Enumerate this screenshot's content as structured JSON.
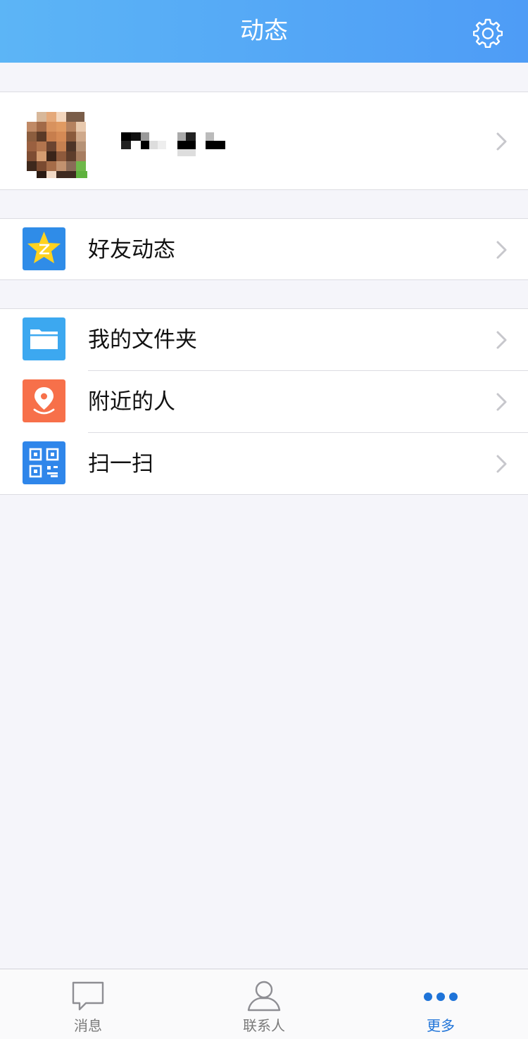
{
  "header": {
    "title": "动态",
    "settings_icon": "gear-icon"
  },
  "profile": {
    "name": ""
  },
  "menu": {
    "friends": {
      "label": "好友动态",
      "icon": "qzone-star-icon",
      "color": "#2f8ce8"
    },
    "files": {
      "label": "我的文件夹",
      "icon": "folder-icon",
      "color": "#3ca8f0"
    },
    "nearby": {
      "label": "附近的人",
      "icon": "location-pin-icon",
      "color": "#f7704a"
    },
    "scan": {
      "label": "扫一扫",
      "icon": "qr-code-icon",
      "color": "#2f86ea"
    }
  },
  "tabbar": {
    "messages": "消息",
    "contacts": "联系人",
    "more": "更多",
    "active": "more",
    "accent": "#1e73d8"
  }
}
